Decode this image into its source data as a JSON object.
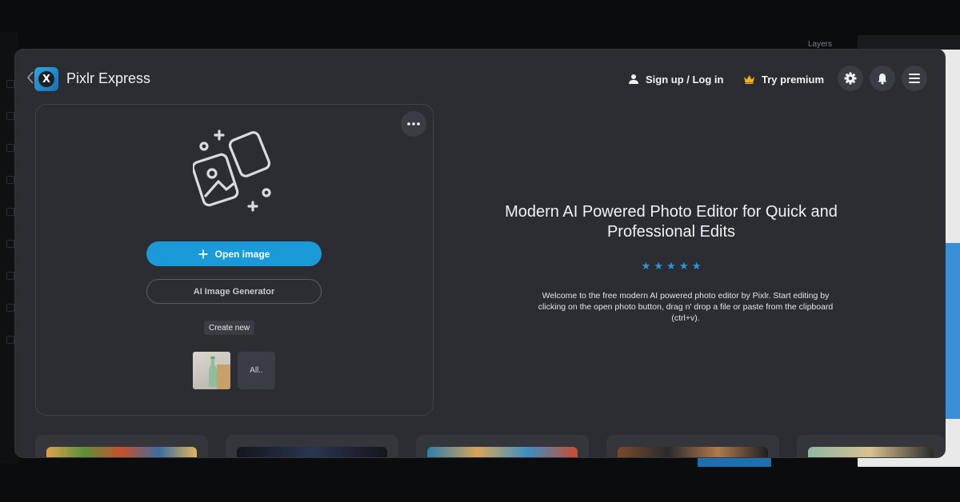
{
  "header": {
    "app_title": "Pixlr Express",
    "signup_label": "Sign up / Log in",
    "premium_label": "Try premium"
  },
  "upload": {
    "open_image_label": "Open image",
    "ai_generator_label": "AI Image Generator",
    "create_new_label": "Create new",
    "all_label": "All.."
  },
  "hero": {
    "title": "Modern AI Powered Photo Editor for Quick and Professional Edits",
    "stars": "★ ★ ★ ★ ★",
    "description": "Welcome to the free modern AI powered photo editor by Pixlr. Start editing by clicking on the open photo button, drag n' drop a file or paste from the clipboard (ctrl+v)."
  },
  "background": {
    "layers_label": "Layers"
  },
  "colors": {
    "accent": "#1a9ad8",
    "star": "#2299e0",
    "premium_crown": "#f2b21b",
    "modal_bg": "#2b2d32"
  },
  "icons": [
    "back-chevron-icon",
    "pixlr-logo-icon",
    "user-icon",
    "crown-icon",
    "gear-icon",
    "bell-icon",
    "hamburger-menu-icon",
    "more-dots-icon",
    "add-images-icon",
    "plus-icon"
  ]
}
